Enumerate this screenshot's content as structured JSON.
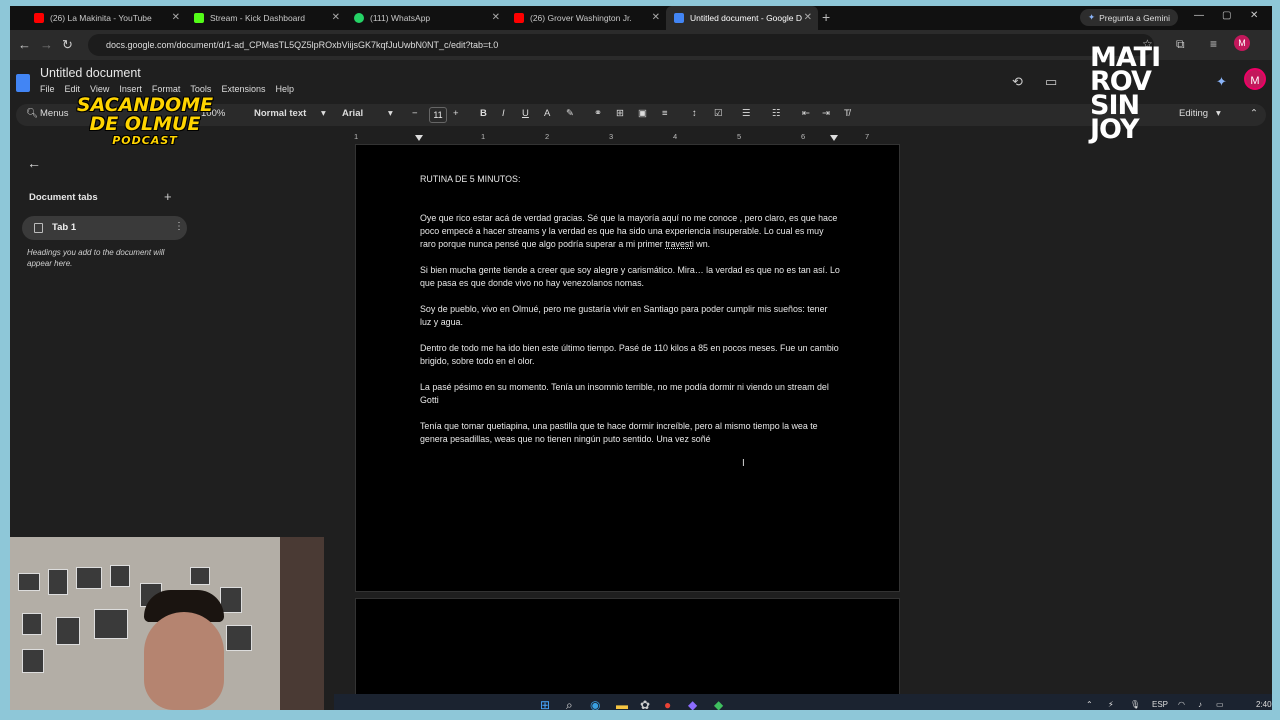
{
  "browser": {
    "tabs": [
      {
        "title": "(26) La Makinita - YouTube",
        "color": "#ff0000",
        "active": false
      },
      {
        "title": "Stream - Kick Dashboard",
        "color": "#53fc18",
        "active": false
      },
      {
        "title": "(111) WhatsApp",
        "color": "#25d366",
        "active": false
      },
      {
        "title": "(26) Grover Washington Jr.",
        "color": "#ff0000",
        "active": false
      },
      {
        "title": "Untitled document - Google D",
        "color": "#4285f4",
        "active": true
      }
    ],
    "gemini_label": "Pregunta a Gemini",
    "url": "docs.google.com/document/d/1-ad_CPMasTL5QZ5lpROxbViijsGK7kqfJuUwbN0NT_c/edit?tab=t.0"
  },
  "docs": {
    "title": "Untitled document",
    "menu": [
      "File",
      "Edit",
      "View",
      "Insert",
      "Format",
      "Tools",
      "Extensions",
      "Help"
    ],
    "toolbar": {
      "menus": "Menus",
      "zoom": "100%",
      "style": "Normal text",
      "font": "Arial",
      "size": "11",
      "editing": "Editing"
    },
    "ruler": [
      "1",
      "1",
      "2",
      "3",
      "4",
      "5",
      "6",
      "7"
    ],
    "sidebar": {
      "heading": "Document tabs",
      "tab_label": "Tab 1",
      "hint": "Headings you add to the document will appear here."
    },
    "content": {
      "heading": "RUTINA DE 5 MINUTOS:",
      "p1a": "Oye que rico estar acá de verdad gracias. Sé que la mayoría aquí no me conoce , pero claro, es que hace poco empecé a hacer streams y  la verdad es que ha sido una experiencia insuperable. Lo cual es muy raro porque nunca pensé que algo podría superar a mi primer ",
      "p1b": "travesti",
      "p1c": " wn.",
      "p2": "Si bien mucha gente tiende a creer que soy alegre y carismático. Mira… la verdad  es que no es tan así. Lo que pasa es que donde vivo no hay venezolanos nomas.",
      "p3": "Soy de pueblo, vivo en Olmué, pero me gustaría vivir en Santiago para poder cumplir mis sueños: tener luz y agua.",
      "p4": "Dentro de todo me ha ido bien este último tiempo. Pasé de 110 kilos a 85 en pocos meses. Fue un cambio brigido, sobre todo en el olor.",
      "p5": "La pasé pésimo en su momento. Tenía un insomnio terrible, no me podía dormir ni viendo un stream del Gotti",
      "p6": "Tenía que tomar quetiapina, una pastilla que te hace dormir increíble, pero al mismo tiempo la wea te genera pesadillas, weas que no tienen ningún puto sentido. Una vez soñé"
    }
  },
  "overlays": {
    "logo_left_line1": "SACANDOME",
    "logo_left_line2": "DE OLMUE",
    "logo_left_line3": "PODCAST",
    "logo_right": [
      "MATI",
      "ROV",
      "SIN",
      "JOY"
    ]
  },
  "taskbar": {
    "lang": "ESP",
    "time": "2:40"
  }
}
